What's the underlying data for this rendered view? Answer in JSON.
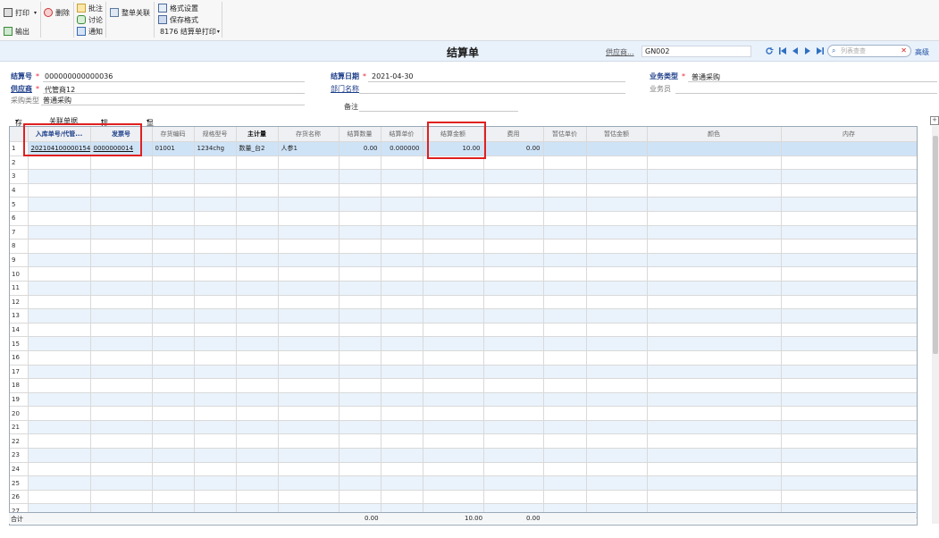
{
  "toolbar": {
    "print": "打印",
    "delete": "删除",
    "export": "输出",
    "approve": "批注",
    "discuss": "讨论",
    "notify": "通知",
    "whole_link": "整单关联",
    "format_settings": "格式设置",
    "save_format": "保存格式",
    "print_template": "8176 结算单打印"
  },
  "titlebar": {
    "title": "结算单",
    "supplier_label": "供应商...",
    "supplier_value": "GN002",
    "search_placeholder": "列表查查",
    "advanced": "高级"
  },
  "header": {
    "settle_no_label": "结算号",
    "settle_no": "000000000000036",
    "settle_date_label": "结算日期",
    "settle_date": "2021-04-30",
    "biz_type_label": "业务类型",
    "biz_type": "普通采购",
    "supplier_label": "供应商",
    "supplier": "代管商12",
    "dept_label": "部门名称",
    "salesman_label": "业务员",
    "purchase_type_label": "采购类型",
    "purchase_type": "普通采购",
    "remark_label": "备注"
  },
  "gridbar": {
    "stock": "存量",
    "linked_docs": "关联单据",
    "sort": "排序定位",
    "display": "显示格式"
  },
  "columns": [
    "入库单号/代管...",
    "发票号",
    "存货编码",
    "规格型号",
    "主计量",
    "存货名称",
    "结算数量",
    "结算单价",
    "结算金额",
    "费用",
    "暂估单价",
    "暂估金额",
    "颜色",
    "内存"
  ],
  "rows": [
    [
      "202104100000154",
      "0000000014",
      "01001",
      "1234chg",
      "数量_台2",
      "人参1",
      "0.00",
      "0.000000",
      "10.00",
      "0.00",
      "",
      "",
      "",
      ""
    ]
  ],
  "row_numbers": [
    "1",
    "2",
    "3",
    "4",
    "5",
    "6",
    "7",
    "8",
    "9",
    "10",
    "11",
    "12",
    "13",
    "14",
    "15",
    "16",
    "17",
    "18",
    "19",
    "20",
    "21",
    "22",
    "23",
    "24",
    "25",
    "26",
    "27"
  ],
  "totals": {
    "label": "合计",
    "qty": "0.00",
    "amount": "10.00",
    "fee": "0.00"
  }
}
